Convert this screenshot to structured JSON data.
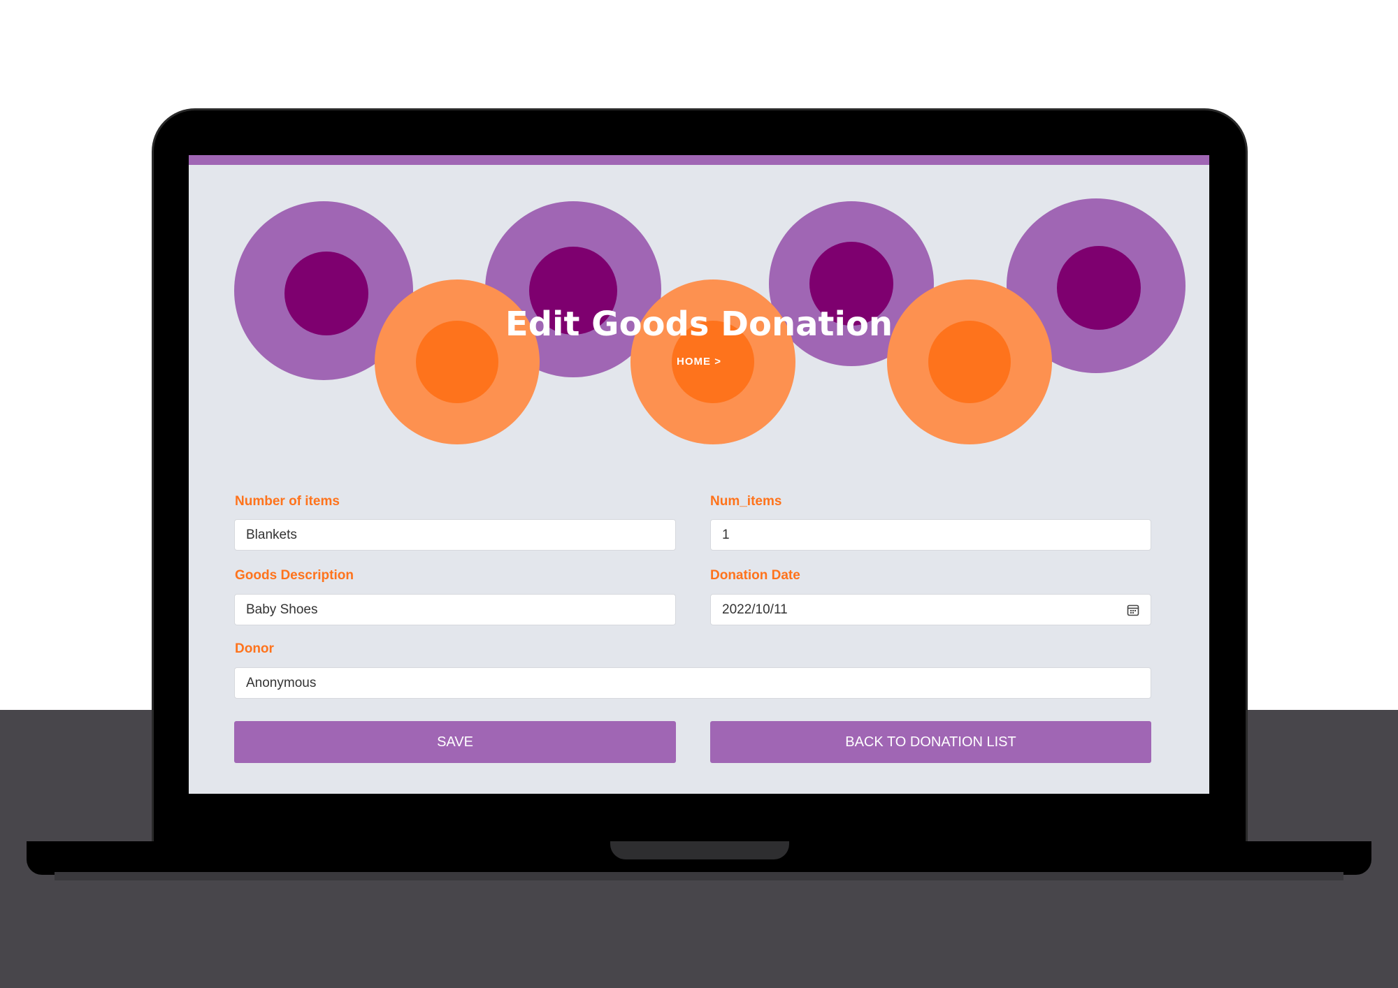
{
  "page": {
    "title": "Edit Goods Donation",
    "breadcrumb": "HOME >"
  },
  "colors": {
    "accent_purple": "#a066b4",
    "dark_purple": "#7e006f",
    "orange_light": "#fd9150",
    "orange": "#fe731c",
    "screen_bg": "#e3e6ec"
  },
  "form": {
    "number_of_items": {
      "label": "Number of items",
      "value": "Blankets"
    },
    "num_items": {
      "label": "Num_items",
      "value": "1"
    },
    "goods_description": {
      "label": "Goods Description",
      "value": "Baby Shoes"
    },
    "donation_date": {
      "label": "Donation Date",
      "value": "2022/10/11",
      "icon": "calendar-icon"
    },
    "donor": {
      "label": "Donor",
      "value": "Anonymous"
    }
  },
  "buttons": {
    "save": "SAVE",
    "back": "BACK TO DONATION LIST"
  }
}
